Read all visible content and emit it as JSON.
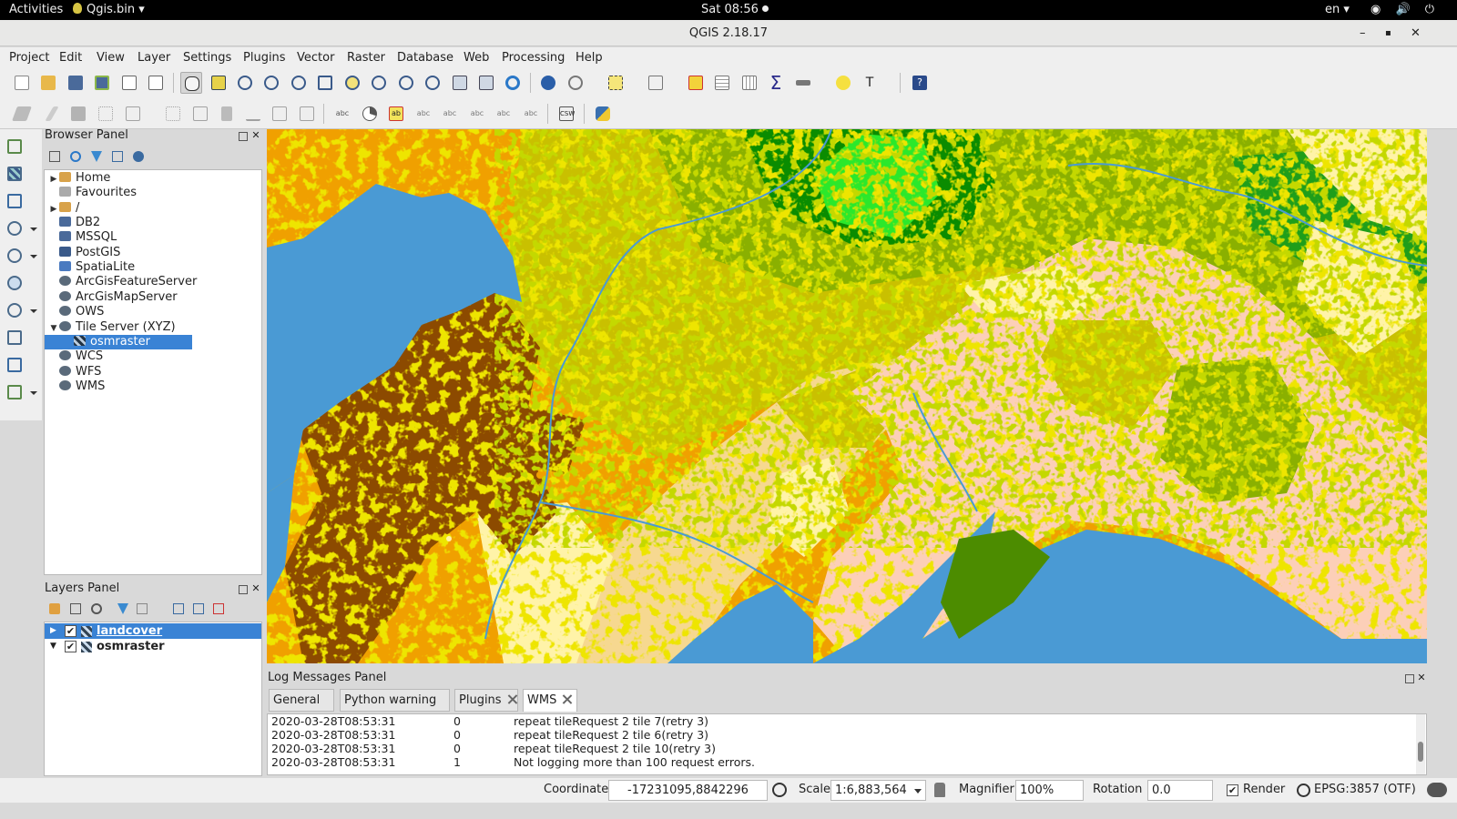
{
  "topbar": {
    "activities": "Activities",
    "app_name": "Qgis.bin ▾",
    "clock": "Sat 08:56",
    "lang": "en ▾",
    "system_icons": "◉ 🔊 ⏻ ▾"
  },
  "window": {
    "title": "QGIS 2.18.17",
    "minimize": "–",
    "maximize": "▪",
    "close": "✕"
  },
  "menu": [
    "Project",
    "Edit",
    "View",
    "Layer",
    "Settings",
    "Plugins",
    "Vector",
    "Raster",
    "Database",
    "Web",
    "Processing",
    "Help"
  ],
  "browser_panel": {
    "title": "Browser Panel",
    "items": [
      {
        "label": "Home",
        "arrow": "▶",
        "icon": "folder-icon"
      },
      {
        "label": "Favourites",
        "arrow": "",
        "icon": "star-icon"
      },
      {
        "label": "/",
        "arrow": "▶",
        "icon": "folder-icon"
      },
      {
        "label": "DB2",
        "arrow": "",
        "icon": "database-icon"
      },
      {
        "label": "MSSQL",
        "arrow": "",
        "icon": "database-icon"
      },
      {
        "label": "PostGIS",
        "arrow": "",
        "icon": "elephant-icon"
      },
      {
        "label": "SpatiaLite",
        "arrow": "",
        "icon": "feather-icon"
      },
      {
        "label": "ArcGisFeatureServer",
        "arrow": "",
        "icon": "globe-icon"
      },
      {
        "label": "ArcGisMapServer",
        "arrow": "",
        "icon": "globe-icon"
      },
      {
        "label": "OWS",
        "arrow": "",
        "icon": "globe-icon"
      },
      {
        "label": "Tile Server (XYZ)",
        "arrow": "▼",
        "icon": "globe-icon"
      },
      {
        "label": "osmraster",
        "arrow": "",
        "icon": "raster-icon"
      },
      {
        "label": "WCS",
        "arrow": "",
        "icon": "globe-icon"
      },
      {
        "label": "WFS",
        "arrow": "",
        "icon": "globe-icon"
      },
      {
        "label": "WMS",
        "arrow": "",
        "icon": "globe-icon"
      }
    ]
  },
  "layers_panel": {
    "title": "Layers Panel",
    "layers": [
      {
        "label": "landcover",
        "arrow": "▶",
        "checked": "✔"
      },
      {
        "label": "osmraster",
        "arrow": "▼",
        "checked": "✔"
      }
    ]
  },
  "log_panel": {
    "title": "Log Messages Panel",
    "tabs": [
      "General",
      "Python warning",
      "Plugins",
      "WMS"
    ],
    "active_tab": "WMS",
    "rows": [
      {
        "time": "2020-03-28T08:53:31",
        "level": "0",
        "message": "repeat tileRequest 2 tile 7(retry 3)"
      },
      {
        "time": "2020-03-28T08:53:31",
        "level": "0",
        "message": "repeat tileRequest 2 tile 6(retry 3)"
      },
      {
        "time": "2020-03-28T08:53:31",
        "level": "0",
        "message": "repeat tileRequest 2 tile 10(retry 3)"
      },
      {
        "time": "2020-03-28T08:53:31",
        "level": "1",
        "message": "Not logging more than 100 request errors."
      }
    ]
  },
  "status": {
    "coordinate_label": "Coordinate",
    "coordinate_value": "-17231095,8842296",
    "scale_label": "Scale",
    "scale_value": "1:6,883,564",
    "magnifier_label": "Magnifier",
    "magnifier_value": "100%",
    "rotation_label": "Rotation",
    "rotation_value": "0.0",
    "render_label": "Render",
    "render_checked": "✔",
    "crs": "EPSG:3857 (OTF)"
  },
  "colors": {
    "selection": "#3a83d5",
    "water": "#4a9ad4",
    "shrub": "#f0a000",
    "grass": "#d4c800",
    "forest": "#8ab000",
    "dense_forest": "#0a8c00",
    "bright_forest": "#22ee22",
    "bare": "#8c4a00",
    "snow": "#fccfb8",
    "tundra": "#fff5b0"
  }
}
